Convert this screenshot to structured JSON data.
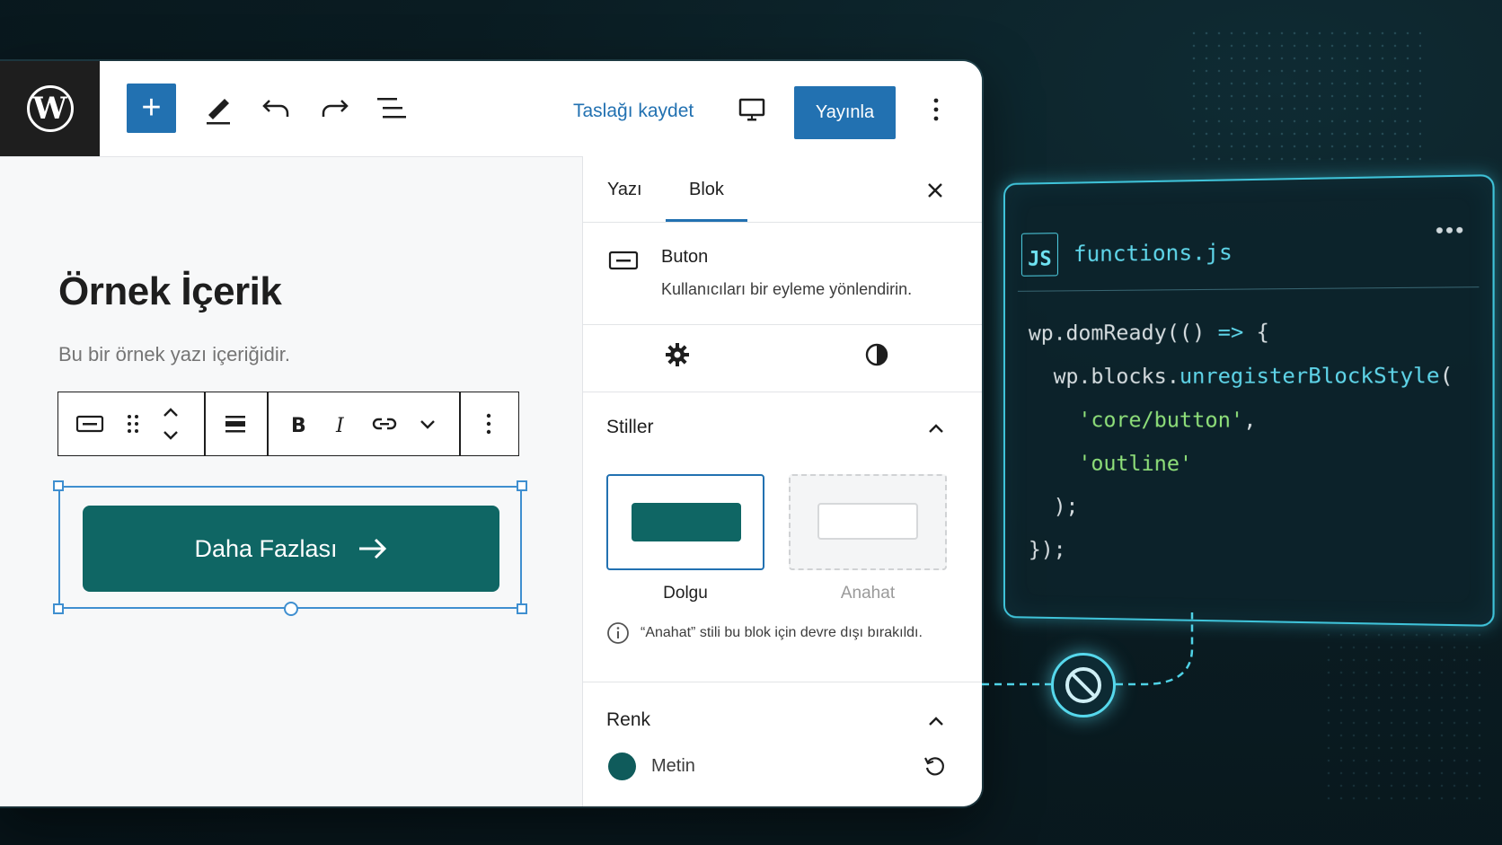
{
  "topbar": {
    "save_draft": "Taslağı kaydet",
    "publish": "Yayınla",
    "add_symbol": "+"
  },
  "canvas": {
    "title": "Örnek İçerik",
    "body": "Bu bir örnek yazı içeriğidir.",
    "cta_label": "Daha Fazlası",
    "cta_color": "#0f6664"
  },
  "sidebar": {
    "tabs": [
      {
        "label": "Yazı"
      },
      {
        "label": "Blok"
      }
    ],
    "block_name": "Buton",
    "block_desc": "Kullanıcıları bir eyleme yönlendirin.",
    "styles_title": "Stiller",
    "style_options": [
      {
        "label": "Dolgu"
      },
      {
        "label": "Anahat"
      }
    ],
    "styles_info": "“Anahat” stili bu blok için devre dışı bırakıldı.",
    "color_title": "Renk",
    "color_text_label": "Metin",
    "accent": "#2271b1"
  },
  "code_card": {
    "file_badge": "JS",
    "file_name": "functions.js",
    "lines": {
      "l1a": "wp.domReady(() ",
      "l1b": "=>",
      "l1c": " {",
      "l2a": "  wp.blocks.",
      "l2b": "unregisterBlockStyle",
      "l2c": "(",
      "l3": "'core/button'",
      "l3b": ",",
      "l4": "'outline'",
      "l5": "  );",
      "l6": "});"
    }
  }
}
